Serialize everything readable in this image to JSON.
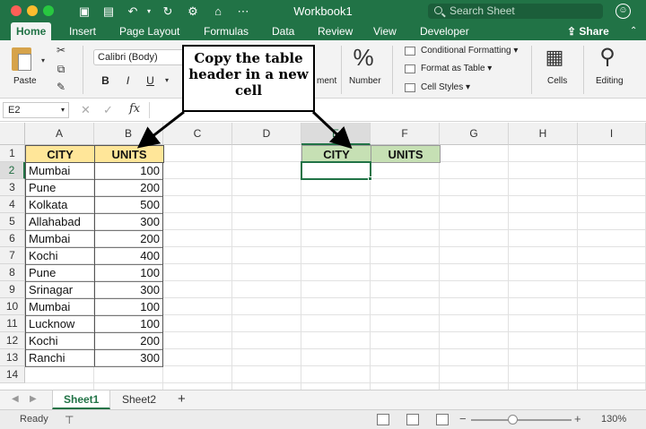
{
  "window": {
    "title": "Workbook1",
    "search_placeholder": "Search Sheet"
  },
  "ribbon_tabs": [
    "Home",
    "Insert",
    "Page Layout",
    "Formulas",
    "Data",
    "Review",
    "View",
    "Developer"
  ],
  "share_label": "Share",
  "ribbon": {
    "paste_label": "Paste",
    "font_name": "Calibri (Body)",
    "bold": "B",
    "italic": "I",
    "underline": "U",
    "alignment_partial": "ment",
    "number_label": "Number",
    "conditional_formatting": "Conditional Formatting",
    "format_as_table": "Format as Table",
    "cell_styles": "Cell Styles",
    "cells_label": "Cells",
    "editing_label": "Editing"
  },
  "formula_bar": {
    "name_box": "E2",
    "fx": "fx"
  },
  "columns": [
    "A",
    "B",
    "C",
    "D",
    "E",
    "F",
    "G",
    "H",
    "I"
  ],
  "rows": [
    "1",
    "2",
    "3",
    "4",
    "5",
    "6",
    "7",
    "8",
    "9",
    "10",
    "11",
    "12",
    "13",
    "14"
  ],
  "table": {
    "headers": [
      "CITY",
      "UNITS"
    ],
    "rows": [
      [
        "Mumbai",
        "100"
      ],
      [
        "Pune",
        "200"
      ],
      [
        "Kolkata",
        "500"
      ],
      [
        "Allahabad",
        "300"
      ],
      [
        "Mumbai",
        "200"
      ],
      [
        "Kochi",
        "400"
      ],
      [
        "Pune",
        "100"
      ],
      [
        "Srinagar",
        "300"
      ],
      [
        "Mumbai",
        "100"
      ],
      [
        "Lucknow",
        "100"
      ],
      [
        "Kochi",
        "200"
      ],
      [
        "Ranchi",
        "300"
      ]
    ]
  },
  "copied_header": [
    "CITY",
    "UNITS"
  ],
  "callout_text": "Copy the table header in a new cell",
  "sheets": [
    "Sheet1",
    "Sheet2"
  ],
  "status": {
    "ready": "Ready",
    "zoom": "130%",
    "minus": "−",
    "plus": "+"
  },
  "colors": {
    "accent": "#217346",
    "header_yellow": "#ffe699",
    "header_green": "#c6e0b4"
  }
}
